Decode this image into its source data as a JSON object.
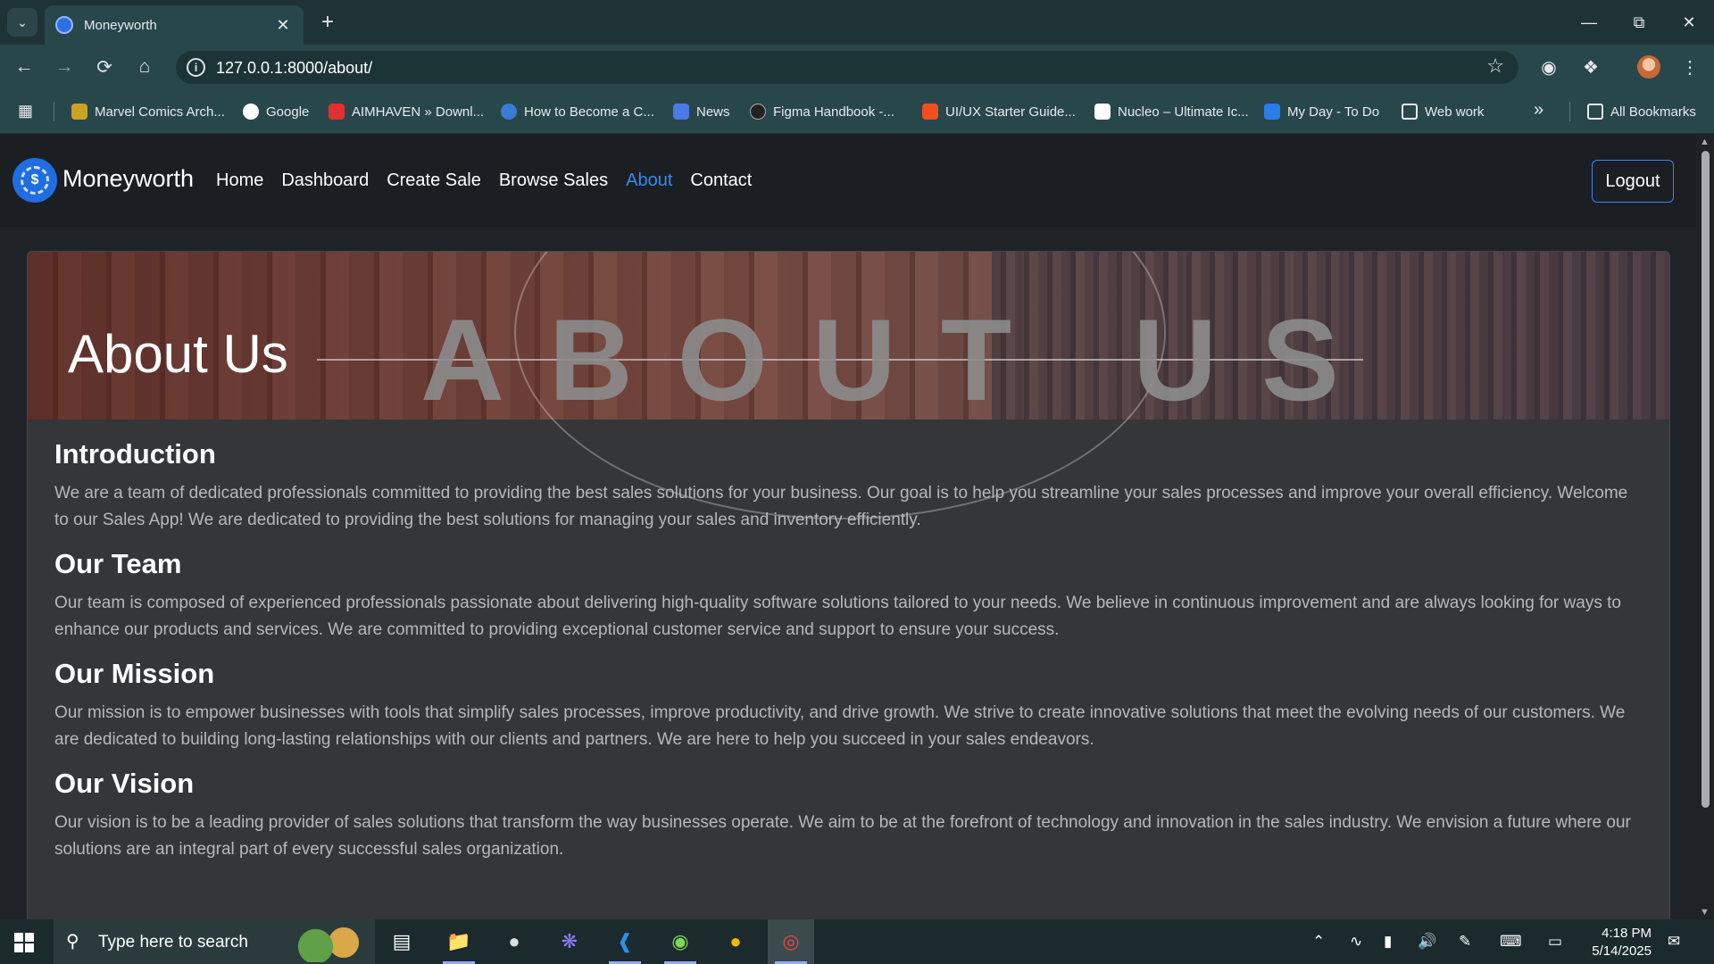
{
  "browser": {
    "tab_title": "Moneyworth",
    "url": "127.0.0.1:8000/about/",
    "bookmarks": [
      {
        "label": "Marvel Comics Arch...",
        "color": "#c9a227"
      },
      {
        "label": "Google",
        "color": "#4285f4"
      },
      {
        "label": "AIMHAVEN » Downl...",
        "color": "#e0302f"
      },
      {
        "label": "How to Become a C...",
        "color": "#3a7bd5"
      },
      {
        "label": "News",
        "color": "#4a79e8"
      },
      {
        "label": "Figma Handbook -...",
        "color": "#222222"
      },
      {
        "label": "UI/UX Starter Guide...",
        "color": "#f24e1e"
      },
      {
        "label": "Nucleo – Ultimate Ic...",
        "color": "#111111"
      },
      {
        "label": "My Day - To Do",
        "color": "#2b7de9"
      },
      {
        "label": "Web work",
        "color": "#28474b"
      }
    ],
    "all_bookmarks": "All Bookmarks"
  },
  "site": {
    "brand": "Moneyworth",
    "logo_glyph": "$",
    "nav": [
      {
        "label": "Home",
        "active": false
      },
      {
        "label": "Dashboard",
        "active": false
      },
      {
        "label": "Create Sale",
        "active": false
      },
      {
        "label": "Browse Sales",
        "active": false
      },
      {
        "label": "About",
        "active": true
      },
      {
        "label": "Contact",
        "active": false
      }
    ],
    "logout": "Logout",
    "accent_color": "#2f8df5"
  },
  "hero": {
    "title": "About Us",
    "watermark": "ABOUT US"
  },
  "sections": [
    {
      "title": "Introduction",
      "text": "We are a team of dedicated professionals committed to providing the best sales solutions for your business. Our goal is to help you streamline your sales processes and improve your overall efficiency. Welcome to our Sales App! We are dedicated to providing the best solutions for managing your sales and inventory efficiently."
    },
    {
      "title": "Our Team",
      "text": "Our team is composed of experienced professionals passionate about delivering high-quality software solutions tailored to your needs. We believe in continuous improvement and are always looking for ways to enhance our products and services. We are committed to providing exceptional customer service and support to ensure your success."
    },
    {
      "title": "Our Mission",
      "text": "Our mission is to empower businesses with tools that simplify sales processes, improve productivity, and drive growth. We strive to create innovative solutions that meet the evolving needs of our customers. We are dedicated to building long-lasting relationships with our clients and partners. We are here to help you succeed in your sales endeavors."
    },
    {
      "title": "Our Vision",
      "text": "Our vision is to be a leading provider of sales solutions that transform the way businesses operate. We aim to be at the forefront of technology and innovation in the sales industry. We envision a future where our solutions are an integral part of every successful sales organization."
    }
  ],
  "taskbar": {
    "search_placeholder": "Type here to search",
    "time": "4:18 PM",
    "date": "5/14/2025"
  }
}
